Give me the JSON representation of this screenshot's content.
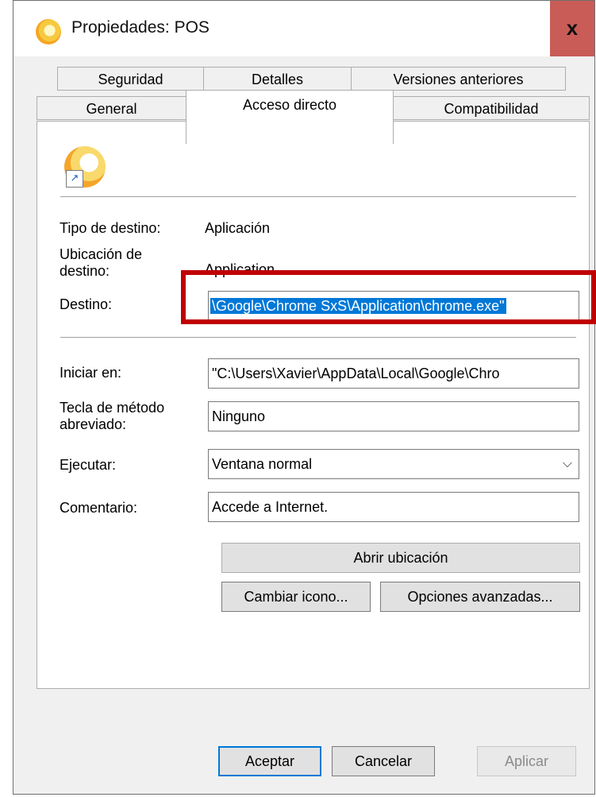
{
  "window": {
    "title": "Propiedades: POS",
    "close_label": "x"
  },
  "tabs_row1": [
    "Seguridad",
    "Detalles",
    "Versiones anteriores"
  ],
  "tabs_row2": [
    "General",
    "Acceso directo",
    "Compatibilidad"
  ],
  "active_tab": "Acceso directo",
  "fields": {
    "target_type_label": "Tipo de destino:",
    "target_type_value": "Aplicación",
    "target_location_label": "Ubicación de destino:",
    "target_location_value": "Application",
    "target_label": "Destino:",
    "target_value": "\\Google\\Chrome SxS\\Application\\chrome.exe\"",
    "start_in_label": "Iniciar en:",
    "start_in_value": "\"C:\\Users\\Xavier\\AppData\\Local\\Google\\Chro",
    "shortcut_key_label": "Tecla de método abreviado:",
    "shortcut_key_value": "Ninguno",
    "run_label": "Ejecutar:",
    "run_value": "Ventana normal",
    "comment_label": "Comentario:",
    "comment_value": "Accede a Internet."
  },
  "buttons": {
    "open_location": "Abrir ubicación",
    "change_icon": "Cambiar icono...",
    "advanced": "Opciones avanzadas...",
    "ok": "Aceptar",
    "cancel": "Cancelar",
    "apply": "Aplicar"
  },
  "icons": {
    "app": "chrome-canary-icon",
    "shortcut_overlay": "shortcut-arrow-icon",
    "dropdown": "chevron-down-icon"
  },
  "colors": {
    "highlight": "#c00000",
    "selection": "#0078d7",
    "close_button": "#c95c57"
  }
}
